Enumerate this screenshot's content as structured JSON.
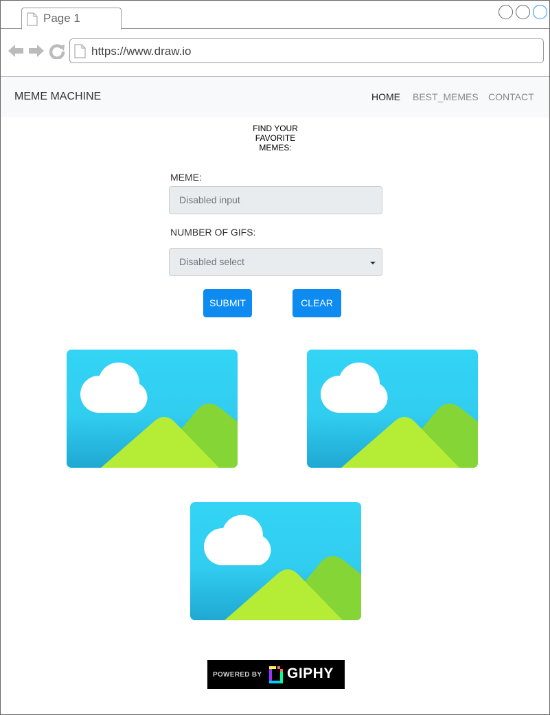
{
  "browser": {
    "tab_label": "Page 1",
    "url": "https://www.draw.io"
  },
  "navbar": {
    "brand": "MEME MACHINE",
    "links": [
      "HOME",
      "BEST_MEMES",
      "CONTACT"
    ],
    "active_link": "HOME"
  },
  "form": {
    "heading": "FIND YOUR\nFAVORITE\nMEMES:",
    "meme_label": "MEME:",
    "meme_value": "Disabled input",
    "gifs_label": "NUMBER OF GIFS:",
    "gifs_selected": "Disabled select",
    "submit_label": "SUBMIT",
    "clear_label": "CLEAR"
  },
  "results": {
    "image_count": 3,
    "image_icon": "image-placeholder-icon"
  },
  "footer": {
    "powered_by": "POWERED BY",
    "giphy_word": "GIPHY"
  },
  "colors": {
    "primary_button": "#0d8bf0",
    "navbar_bg": "#f8f9fa",
    "disabled_field_bg": "#e9ecef"
  }
}
